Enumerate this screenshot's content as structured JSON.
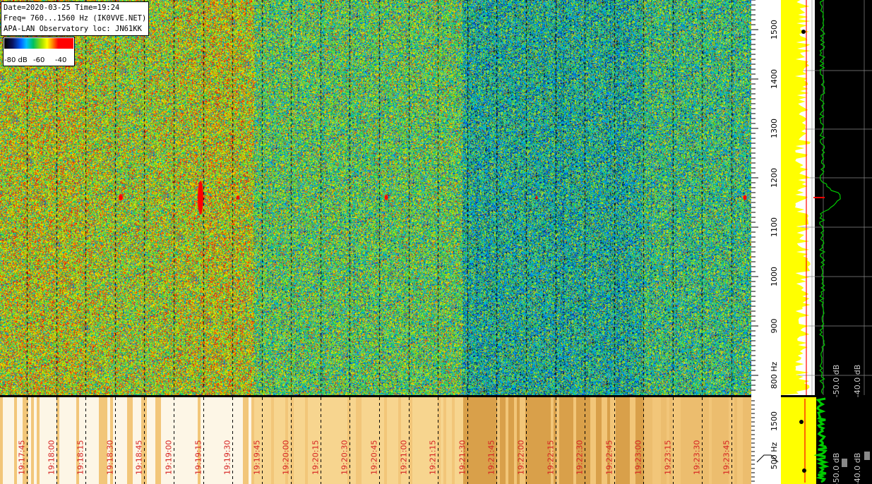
{
  "info": {
    "line1": "Date=2020-03-25 Time=19:24",
    "line2": "Freq= 760...1560 Hz (IK0VVE.NET)",
    "line3": "APA-LAN Observatory loc: JN61KK"
  },
  "color_scale": {
    "min_label": "-80 dB",
    "mid_label": "-60",
    "max_label": "-40"
  },
  "freq_axis": {
    "min_hz": 760,
    "max_hz": 1560,
    "ticks": [
      "1500",
      "1400",
      "1300",
      "1200",
      "1100",
      "1000",
      "900",
      "800 Hz"
    ]
  },
  "lower_axis": {
    "ticks": [
      "1500",
      "500 Hz"
    ]
  },
  "spectrum_scale": {
    "upper": [
      "-50.0 dB",
      "-40.0 dB"
    ],
    "lower": [
      "-50.0 dB",
      "-40.0 dB"
    ]
  },
  "time_labels": [
    "19:17:45",
    "19:18:00",
    "19:18:15",
    "19:18:30",
    "19:18:45",
    "19:19:00",
    "19:19:15",
    "19:19:30",
    "19:19:45",
    "19:20:00",
    "19:20:15",
    "19:20:30",
    "19:20:45",
    "19:21:00",
    "19:21:15",
    "19:21:30",
    "19:21:45",
    "19:22:00",
    "19:22:15",
    "19:22:30",
    "19:22:45",
    "19:23:00",
    "19:23:15",
    "19:23:30",
    "19:23:45"
  ],
  "signal_freq_hz": 1160,
  "colors": {
    "spectrum_fill": "#ffff00",
    "spectrum_peak": "#00cc00",
    "marker": "#ff0000",
    "panel_bg": "#000000"
  }
}
